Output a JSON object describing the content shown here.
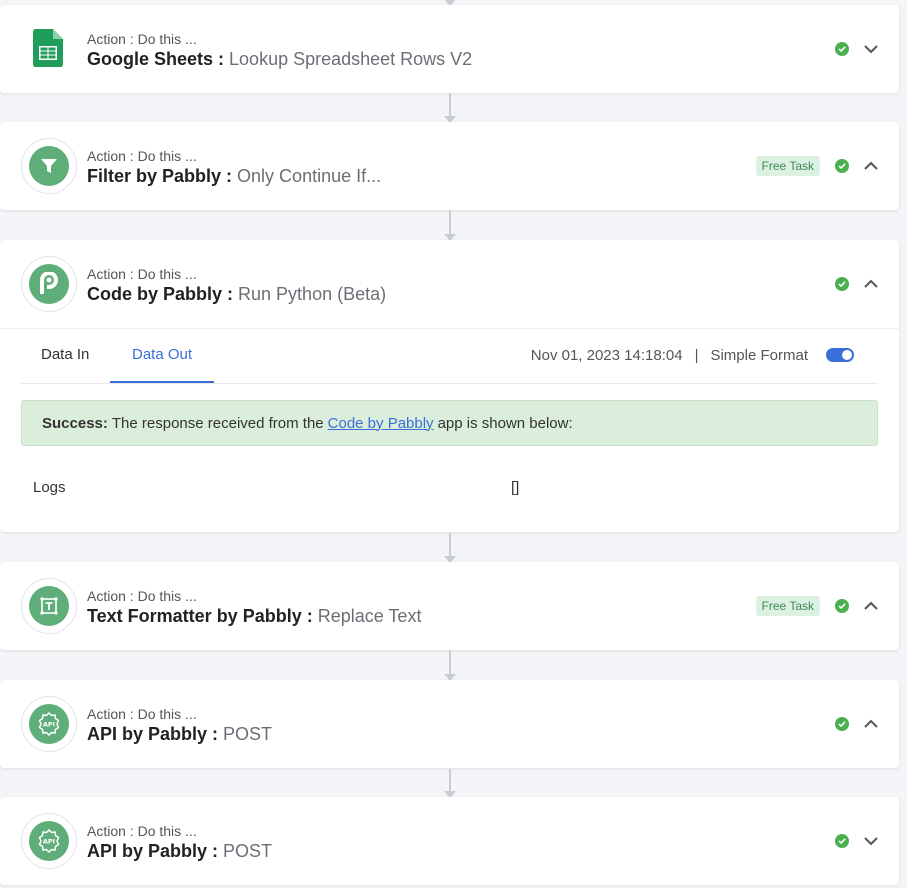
{
  "steps": [
    {
      "action_label": "Action : Do this ...",
      "app": "Google Sheets",
      "separator": " : ",
      "event": "Lookup Spreadsheet Rows V2",
      "icon": "google-sheets-icon",
      "free_task": "",
      "chevron": "down"
    },
    {
      "action_label": "Action : Do this ...",
      "app": "Filter by Pabbly",
      "separator": " : ",
      "event": "Only Continue If...",
      "icon": "filter-icon",
      "free_task": "Free Task",
      "chevron": "up"
    },
    {
      "action_label": "Action : Do this ...",
      "app": "Code by Pabbly",
      "separator": " : ",
      "event": "Run Python (Beta)",
      "icon": "pabbly-p-icon",
      "free_task": "",
      "chevron": "up"
    },
    {
      "action_label": "Action : Do this ...",
      "app": "Text Formatter by Pabbly",
      "separator": " : ",
      "event": "Replace Text",
      "icon": "text-formatter-icon",
      "free_task": "Free Task",
      "chevron": "up"
    },
    {
      "action_label": "Action : Do this ...",
      "app": "API by Pabbly",
      "separator": " : ",
      "event": "POST",
      "icon": "api-icon",
      "free_task": "",
      "chevron": "up"
    },
    {
      "action_label": "Action : Do this ...",
      "app": "API by Pabbly",
      "separator": " : ",
      "event": "POST",
      "icon": "api-icon",
      "free_task": "",
      "chevron": "down"
    }
  ],
  "expanded": {
    "tab_in": "Data In",
    "tab_out": "Data Out",
    "timestamp": "Nov 01, 2023 14:18:04",
    "divider": "|",
    "format_label": "Simple Format",
    "success_bold": "Success:",
    "success_pre": "The response received from the",
    "success_link": "Code by Pabbly",
    "success_post": "app is shown below:",
    "logs_key": "Logs",
    "logs_value": "[]"
  },
  "colors": {
    "accent": "#3b6fd8",
    "success_green": "#4caf50",
    "icon_green": "#5fae7a",
    "success_bg": "#dbeedb"
  }
}
